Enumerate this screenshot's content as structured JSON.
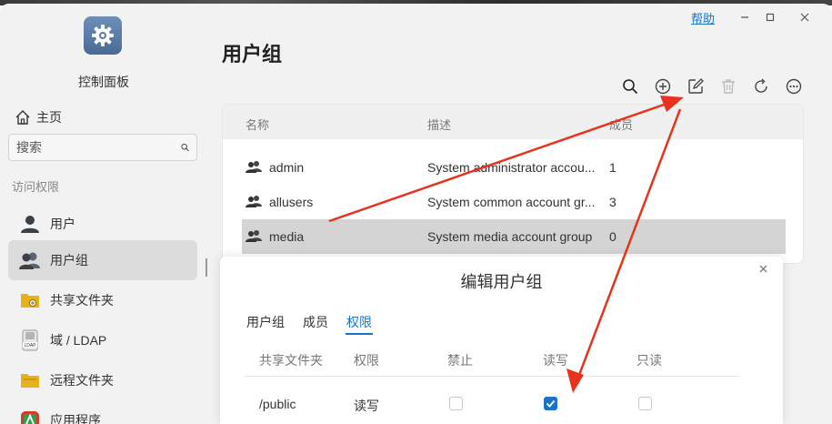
{
  "app": {
    "title": "控制面板",
    "help": "帮助"
  },
  "sidebar": {
    "home": "主页",
    "search_placeholder": "搜索",
    "section": "访问权限",
    "items": [
      {
        "label": "用户",
        "icon": "user-icon"
      },
      {
        "label": "用户组",
        "icon": "user-group-icon"
      },
      {
        "label": "共享文件夹",
        "icon": "shared-folder-icon"
      },
      {
        "label": "域 / LDAP",
        "icon": "ldap-icon"
      },
      {
        "label": "远程文件夹",
        "icon": "remote-folder-icon"
      },
      {
        "label": "应用程序",
        "icon": "application-icon"
      }
    ]
  },
  "main": {
    "title": "用户组",
    "toolbar": [
      "search-icon",
      "add-icon",
      "edit-icon",
      "delete-icon",
      "refresh-icon",
      "more-icon"
    ],
    "columns": [
      "名称",
      "描述",
      "成员"
    ],
    "rows": [
      {
        "name": "admin",
        "description": "System administrator accou...",
        "members": "1"
      },
      {
        "name": "allusers",
        "description": "System common account gr...",
        "members": "3"
      },
      {
        "name": "media",
        "description": "System media account group",
        "members": "0"
      }
    ],
    "selected_row": 2
  },
  "dialog": {
    "title": "编辑用户组",
    "tabs": [
      "用户组",
      "成员",
      "权限"
    ],
    "active_tab": 2,
    "columns": [
      "共享文件夹",
      "权限",
      "禁止",
      "读写",
      "只读"
    ],
    "rows": [
      {
        "folder": "/public",
        "permission": "读写",
        "deny": false,
        "readwrite": true,
        "readonly": false
      }
    ]
  },
  "colors": {
    "accent": "#1a73c9",
    "annotation": "#e8321e"
  }
}
